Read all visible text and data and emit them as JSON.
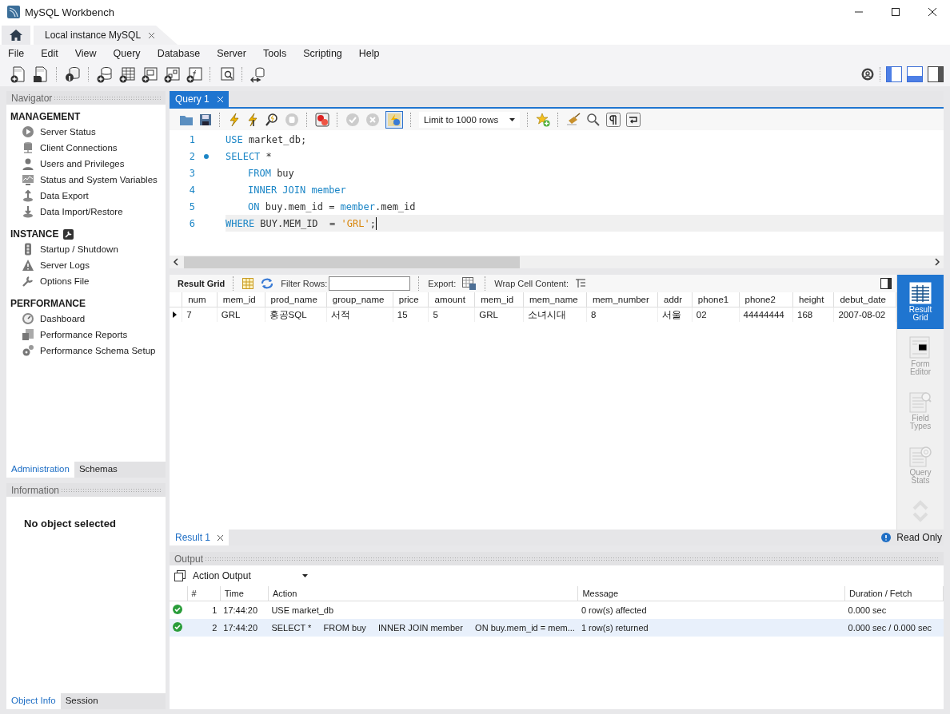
{
  "window": {
    "title": "MySQL Workbench"
  },
  "connection_tabs": [
    {
      "label": "Local instance MySQL"
    }
  ],
  "menu": [
    "File",
    "Edit",
    "View",
    "Query",
    "Database",
    "Server",
    "Tools",
    "Scripting",
    "Help"
  ],
  "navigator": {
    "title": "Navigator",
    "sections": [
      {
        "title": "MANAGEMENT",
        "kind": "plain",
        "items": [
          {
            "label": "Server Status",
            "kind": "status"
          },
          {
            "label": "Client Connections",
            "kind": "connections"
          },
          {
            "label": "Users and Privileges",
            "kind": "user"
          },
          {
            "label": "Status and System Variables",
            "kind": "monitor"
          },
          {
            "label": "Data Export",
            "kind": "export"
          },
          {
            "label": "Data Import/Restore",
            "kind": "import"
          }
        ]
      },
      {
        "title": "INSTANCE",
        "kind": "wrench",
        "items": [
          {
            "label": "Startup / Shutdown",
            "kind": "traffic"
          },
          {
            "label": "Server Logs",
            "kind": "warning"
          },
          {
            "label": "Options File",
            "kind": "wrench"
          }
        ]
      },
      {
        "title": "PERFORMANCE",
        "kind": "plain",
        "items": [
          {
            "label": "Dashboard",
            "kind": "gauge"
          },
          {
            "label": "Performance Reports",
            "kind": "reports"
          },
          {
            "label": "Performance Schema Setup",
            "kind": "gears"
          }
        ]
      }
    ]
  },
  "sidebar_tabs": [
    {
      "label": "Administration",
      "selected": true
    },
    {
      "label": "Schemas",
      "selected": false
    }
  ],
  "information": {
    "title": "Information",
    "message": "No object selected"
  },
  "info_tabs": [
    {
      "label": "Object Info",
      "selected": true
    },
    {
      "label": "Session",
      "selected": false
    }
  ],
  "query_tabs": [
    {
      "label": "Query 1",
      "selected": true
    }
  ],
  "editor_toolbar": {
    "autocommit": true,
    "limit": "Limit to 1000 rows"
  },
  "editor": {
    "lines": [
      {
        "number": "1",
        "marker": false,
        "indented": false,
        "current": false,
        "tokens": [
          {
            "text": "USE",
            "kind": "keyword"
          },
          {
            "text": " market_db;",
            "kind": "text"
          }
        ]
      },
      {
        "number": "2",
        "marker": true,
        "indented": false,
        "current": false,
        "tokens": [
          {
            "text": "SELECT",
            "kind": "keyword"
          },
          {
            "text": " *",
            "kind": "text"
          }
        ]
      },
      {
        "number": "3",
        "marker": false,
        "indented": true,
        "current": false,
        "tokens": [
          {
            "text": "FROM",
            "kind": "keyword"
          },
          {
            "text": " buy",
            "kind": "text"
          }
        ]
      },
      {
        "number": "4",
        "marker": false,
        "indented": true,
        "current": false,
        "tokens": [
          {
            "text": "INNER JOIN",
            "kind": "keyword"
          },
          {
            "text": " member",
            "kind": "identifier"
          }
        ]
      },
      {
        "number": "5",
        "marker": false,
        "indented": true,
        "current": false,
        "tokens": [
          {
            "text": "ON",
            "kind": "keyword"
          },
          {
            "text": " buy.mem_id = ",
            "kind": "text"
          },
          {
            "text": "member",
            "kind": "identifier"
          },
          {
            "text": ".mem_id",
            "kind": "text"
          }
        ]
      },
      {
        "number": "6",
        "marker": false,
        "indented": false,
        "current": true,
        "tokens": [
          {
            "text": "WHERE",
            "kind": "keyword"
          },
          {
            "text": " BUY.MEM_ID  = ",
            "kind": "text"
          },
          {
            "text": "'GRL'",
            "kind": "string"
          },
          {
            "text": ";",
            "kind": "text"
          }
        ]
      }
    ]
  },
  "result_toolbar": {
    "title": "Result Grid",
    "filter_label": "Filter Rows:",
    "export_label": "Export:",
    "wrap_label": "Wrap Cell Content:"
  },
  "result_grid": {
    "columns": [
      "num",
      "mem_id",
      "prod_name",
      "group_name",
      "price",
      "amount",
      "mem_id",
      "mem_name",
      "mem_number",
      "addr",
      "phone1",
      "phone2",
      "height",
      "debut_date"
    ],
    "rows": [
      {
        "current": true,
        "cells": [
          "7",
          "GRL",
          "홍공SQL",
          "서적",
          "15",
          "5",
          "GRL",
          "소녀시대",
          "8",
          "서울",
          "02",
          "44444444",
          "168",
          "2007-08-02"
        ]
      }
    ]
  },
  "result_views": [
    {
      "label": "Result Grid",
      "kind": "grid",
      "selected": true
    },
    {
      "label": "Form Editor",
      "kind": "form",
      "selected": false
    },
    {
      "label": "Field Types",
      "kind": "fields",
      "selected": false
    },
    {
      "label": "Query Stats",
      "kind": "stats",
      "selected": false
    }
  ],
  "result_tabs": [
    {
      "label": "Result 1",
      "selected": true
    }
  ],
  "read_only": "Read Only",
  "output": {
    "title": "Output",
    "selector": "Action Output",
    "columns": [
      "#",
      "Time",
      "Action",
      "Message",
      "Duration / Fetch"
    ],
    "rows": [
      {
        "kind": "success",
        "selected": false,
        "cells": [
          "1",
          "17:44:20",
          "USE market_db",
          "0 row(s) affected",
          "0.000 sec"
        ]
      },
      {
        "kind": "success",
        "selected": true,
        "cells": [
          "2",
          "17:44:20",
          "SELECT *     FROM buy     INNER JOIN member     ON buy.mem_id = mem...",
          "1 row(s) returned",
          "0.000 sec / 0.000 sec"
        ]
      }
    ]
  }
}
